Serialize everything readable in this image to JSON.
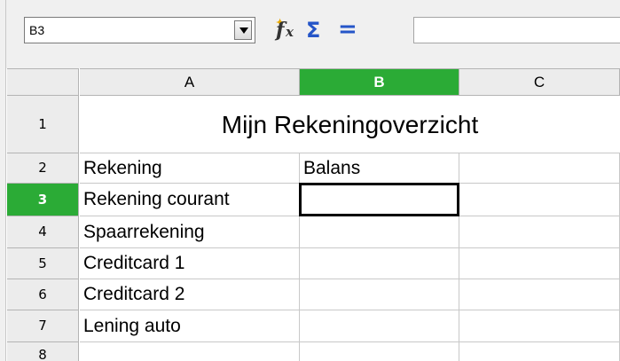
{
  "formula_bar": {
    "name_box_value": "B3",
    "formula_input_value": ""
  },
  "icons": {
    "name_box_dropdown": "chevron-down-icon",
    "function_wizard": "function-wizard-icon",
    "sum": "sigma-icon",
    "formula": "equals-icon"
  },
  "columns": [
    {
      "label": "A",
      "active": false
    },
    {
      "label": "B",
      "active": true
    },
    {
      "label": "C",
      "active": false
    }
  ],
  "rows": [
    {
      "label": "1",
      "active": false
    },
    {
      "label": "2",
      "active": false
    },
    {
      "label": "3",
      "active": true
    },
    {
      "label": "4",
      "active": false
    },
    {
      "label": "5",
      "active": false
    },
    {
      "label": "6",
      "active": false
    },
    {
      "label": "7",
      "active": false
    },
    {
      "label": "8",
      "active": false
    }
  ],
  "sheet": {
    "title": "Mijn Rekeningoverzicht",
    "A2": "Rekening",
    "B2": "Balans",
    "A3": "Rekening courant",
    "A4": "Spaarrekening",
    "A5": "Creditcard 1",
    "A6": "Creditcard 2",
    "A7": "Lening auto",
    "selected_cell": "B3"
  },
  "colors": {
    "active_header": "#2bab36",
    "header_bg": "#ececec",
    "toolbar_bg": "#f0f0f0",
    "sum_icon": "#2555c8"
  }
}
